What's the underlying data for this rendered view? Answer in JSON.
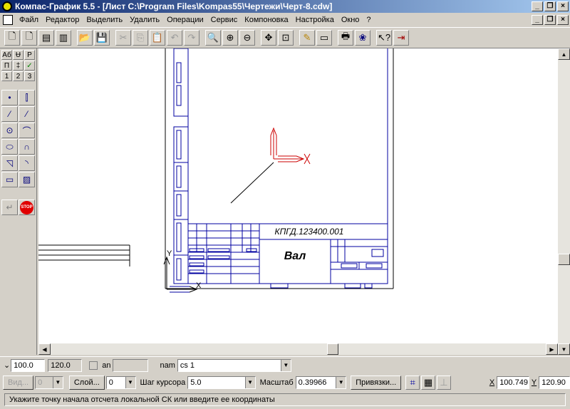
{
  "window": {
    "title": "Компас-График 5.5 - [Лист C:\\Program Files\\Kompas55\\Чертежи\\Черт-8.cdw]"
  },
  "menu": [
    "Файл",
    "Редактор",
    "Выделить",
    "Удалить",
    "Операции",
    "Сервис",
    "Компоновка",
    "Настройка",
    "Окно",
    "?"
  ],
  "drawing": {
    "designation": "КПГД.123400.001",
    "part_name": "Вал",
    "axis_x": "X",
    "axis_y": "Y"
  },
  "left_panel": {
    "top_labels": [
      "Аб",
      "Ʉ",
      "Р",
      "П",
      "‡",
      "✓",
      "1",
      "2",
      "3"
    ],
    "stop_label": "STOP"
  },
  "props": {
    "coord_x": "100.0",
    "coord_y": "120.0",
    "angle_label": "an",
    "angle_value": "",
    "name_label": "nam",
    "name_value": "cs 1"
  },
  "status": {
    "view_label": "Вид...",
    "view_value": "0",
    "layer_label": "Слой...",
    "layer_value": "0",
    "step_label": "Шаг курсора",
    "step_value": "5.0",
    "scale_label": "Масштаб",
    "scale_value": "0.39966",
    "snap_label": "Привязки...",
    "x_label": "X",
    "x_value": "100.749",
    "y_label": "Y",
    "y_value": "120.90"
  },
  "status_message": "Укажите точку начала отсчета локальной СК или введите ее координаты",
  "colors": {
    "title_start": "#0a246a",
    "title_end": "#a6caf0",
    "frame_blue": "#0000a0",
    "csys_red": "#cc0000"
  }
}
